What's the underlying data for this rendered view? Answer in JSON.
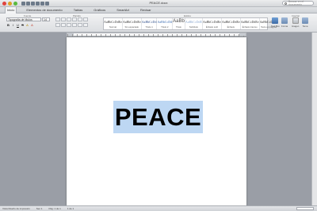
{
  "window": {
    "title": "PEACE.docx"
  },
  "search": {
    "placeholder": "Buscar en el documento"
  },
  "tabs": [
    "Inicio",
    "Elementos de documento",
    "Tablas",
    "Gráficos",
    "SmartArt",
    "Revisar"
  ],
  "ribbon": {
    "group_font": "Fuente",
    "group_paragraph": "Párrafo",
    "group_styles": "Estilos",
    "group_insert": "Insertar",
    "font_name": "Tipografía de títulos",
    "font_size": "14",
    "format_buttons": [
      "B",
      "I",
      "U",
      "S",
      "A",
      "A"
    ],
    "styles": [
      {
        "preview": "AaBbCcDdEe",
        "label": "Normal"
      },
      {
        "preview": "AaBbCcDdEe",
        "label": "Sin espaciado"
      },
      {
        "preview": "AaBbCcDd",
        "label": "Título 1"
      },
      {
        "preview": "AaBbCcDd",
        "label": "Título 2"
      },
      {
        "preview": "AaBb",
        "label": "Título"
      },
      {
        "preview": "AaBbCcDdE",
        "label": "Subtítulo"
      },
      {
        "preview": "AaBbCcDdEe",
        "label": "Énfasis sutil"
      },
      {
        "preview": "AaBbCcDdEe",
        "label": "Énfasis"
      },
      {
        "preview": "AaBbCcDdEe",
        "label": "Énfasis intenso"
      },
      {
        "preview": "AaBbCcDdEe",
        "label": "Texto en negrita"
      }
    ],
    "insert": [
      {
        "label": "Text Box",
        "icon": "textbox-icon"
      },
      {
        "label": "Forma",
        "icon": "shape-icon"
      },
      {
        "label": "Imagen",
        "icon": "image-icon"
      },
      {
        "label": "Tema",
        "icon": "theme-icon"
      }
    ]
  },
  "document": {
    "text": "PEACE"
  },
  "status": {
    "view": "Vista Diseño de impresión",
    "sections": "Sec 1",
    "pages": "Pág: 1 de 1",
    "words": "1 de 1"
  }
}
